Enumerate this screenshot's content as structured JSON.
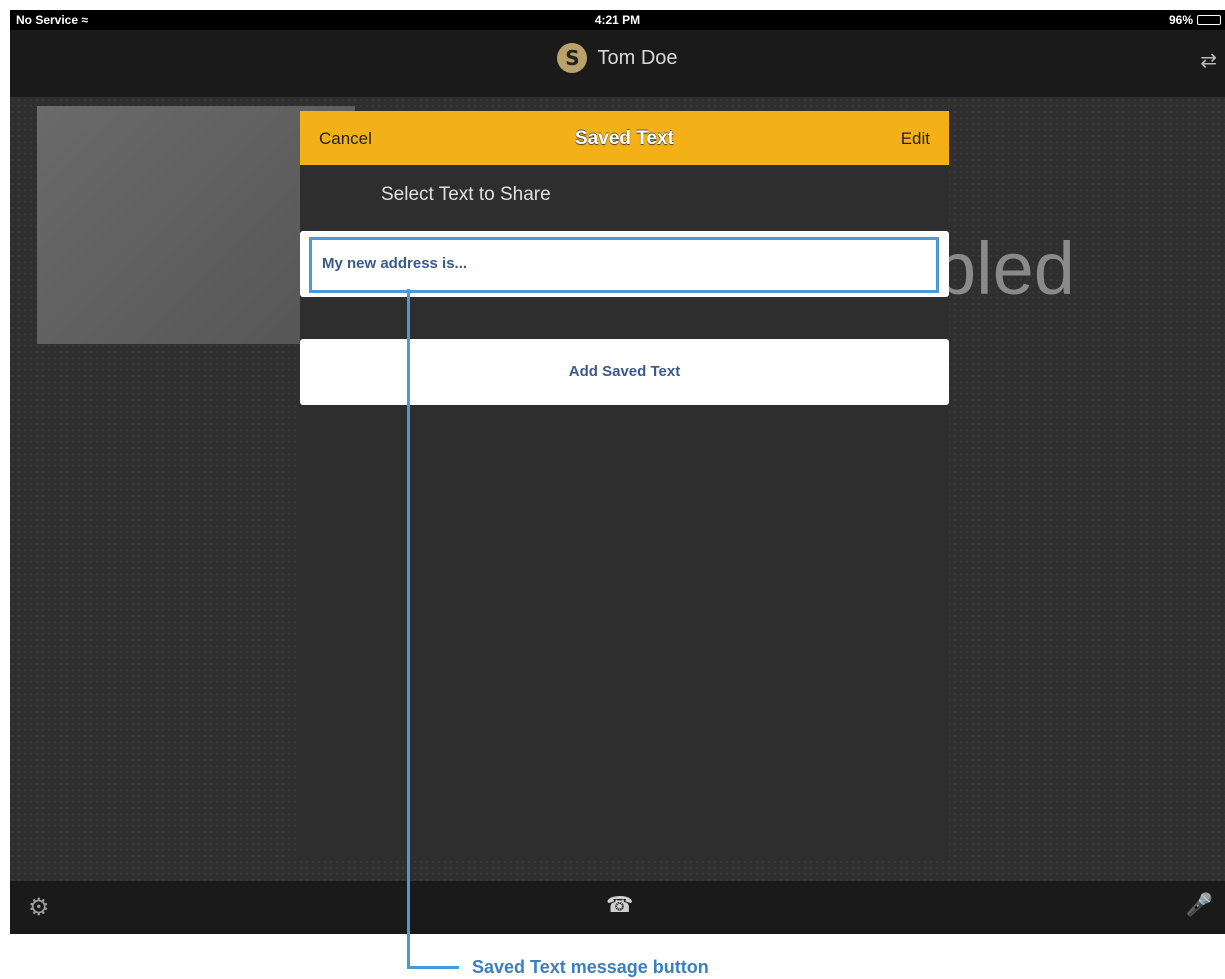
{
  "status_bar": {
    "carrier": "No Service",
    "time": "4:21 PM",
    "battery": "96%"
  },
  "nav": {
    "caller_name": "Tom Doe",
    "logo_letter": "S"
  },
  "background": {
    "status_text_fragment": "bled"
  },
  "modal": {
    "cancel_label": "Cancel",
    "title": "Saved Text",
    "edit_label": "Edit",
    "section_label": "Select Text to Share",
    "saved_items": [
      {
        "text": "My new address is..."
      }
    ],
    "add_label": "Add Saved Text"
  },
  "callout": {
    "label": "Saved Text message button",
    "color": "#4a9ad8"
  },
  "colors": {
    "header_accent": "#f3b117",
    "link_text": "#3a5a8c"
  }
}
